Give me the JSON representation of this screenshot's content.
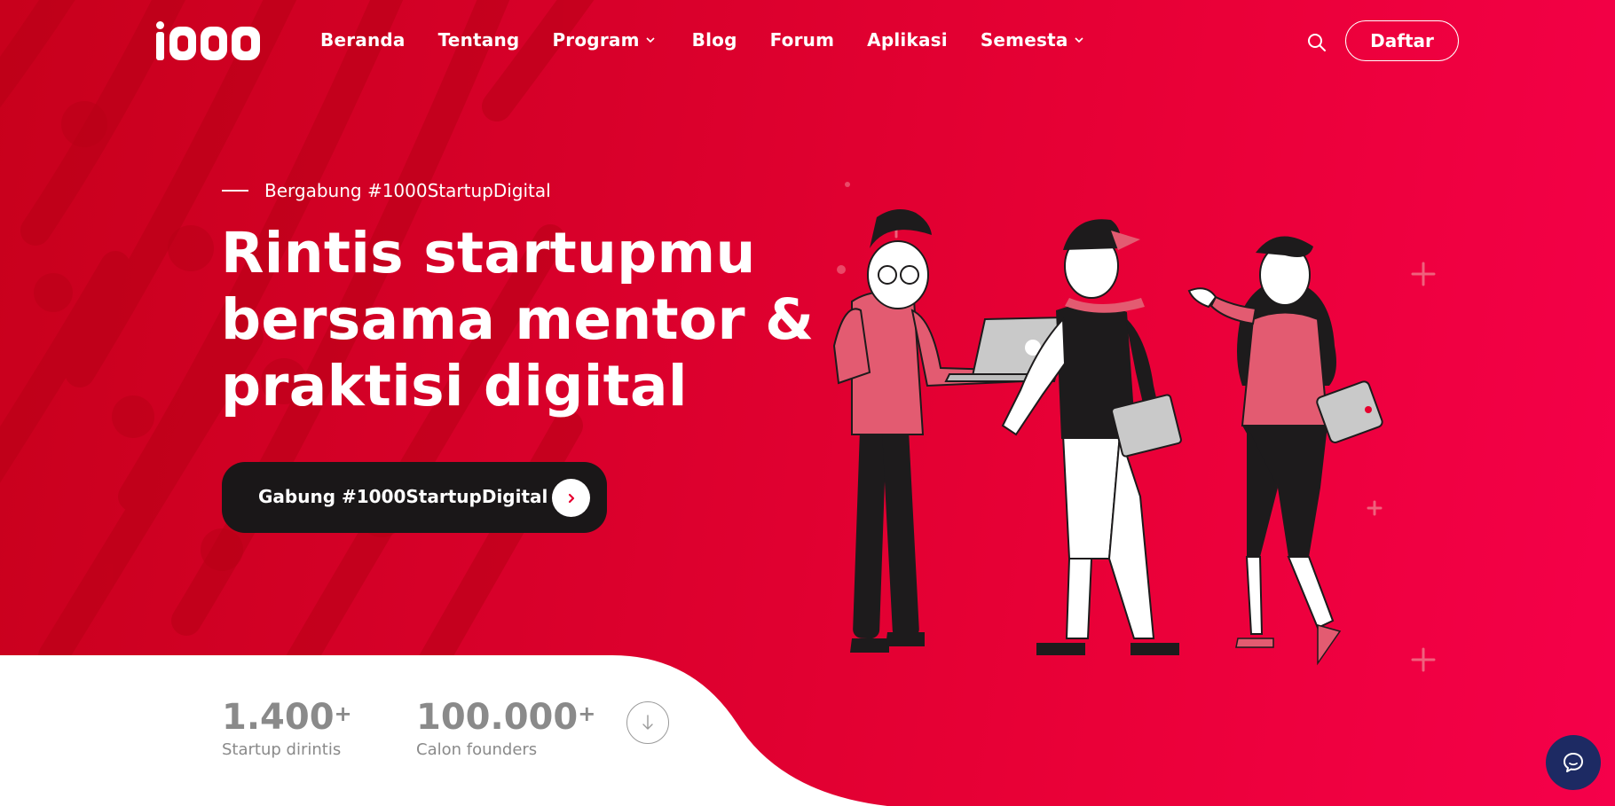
{
  "brand": {
    "logo_text": "1000"
  },
  "nav": {
    "items": [
      {
        "label": "Beranda",
        "dropdown": false
      },
      {
        "label": "Tentang",
        "dropdown": false
      },
      {
        "label": "Program",
        "dropdown": true
      },
      {
        "label": "Blog",
        "dropdown": false
      },
      {
        "label": "Forum",
        "dropdown": false
      },
      {
        "label": "Aplikasi",
        "dropdown": false
      },
      {
        "label": "Semesta",
        "dropdown": true
      }
    ],
    "search_icon": "search-icon",
    "register_label": "Daftar"
  },
  "hero": {
    "eyebrow": "Bergabung #1000StartupDigital",
    "headline_lines": [
      "Rintis startupmu",
      "bersama mentor &",
      "praktisi digital"
    ],
    "cta_label": "Gabung #1000StartupDigital",
    "cta_icon": "chevron-right-icon"
  },
  "stats": [
    {
      "value": "1.400",
      "suffix": "+",
      "label": "Startup dirintis"
    },
    {
      "value": "100.000",
      "suffix": "+",
      "label": "Calon founders"
    }
  ],
  "scroll_icon": "arrow-down-icon",
  "chat_icon": "chat-icon",
  "colors": {
    "primary_red": "#e6002f",
    "dark": "#1a1718",
    "chat_navy": "#1d2a63",
    "stat_gray": "#8a8a8a"
  }
}
